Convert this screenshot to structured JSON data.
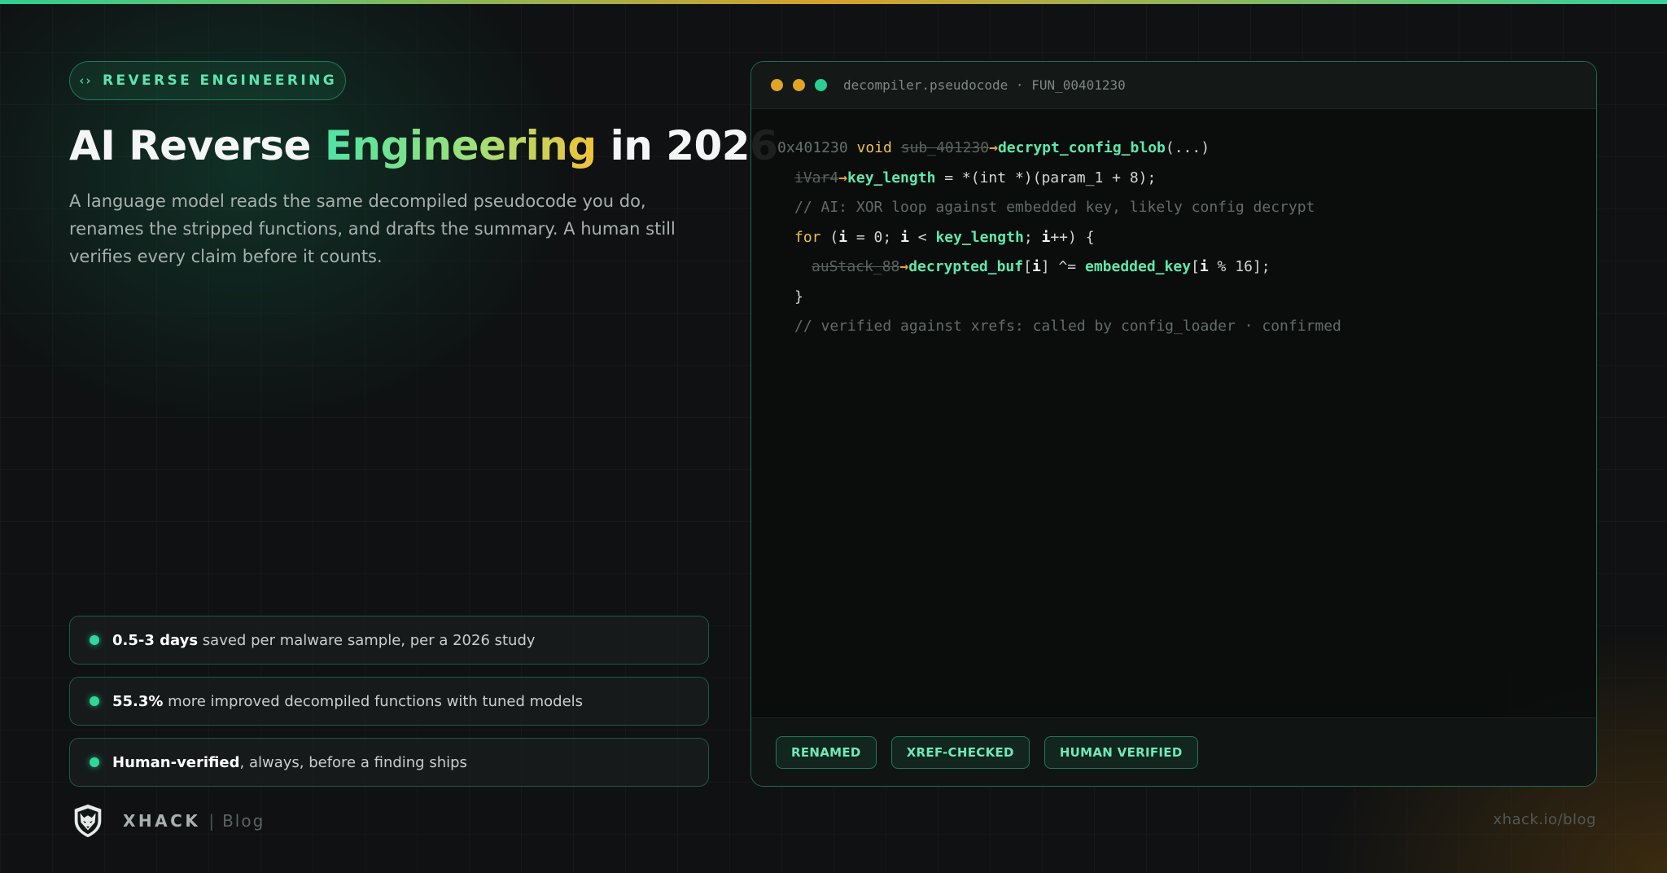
{
  "colors": {
    "accent_green": "#2fd896",
    "accent_amber": "#e0a526",
    "background": "#0f1112"
  },
  "header": {
    "tag_icon": "‹›",
    "tag_label": "REVERSE ENGINEERING",
    "title_before": "AI Reverse ",
    "title_accent": "Engineering",
    "title_after": " in 2026",
    "intro": "A language model reads the same decompiled pseudocode you do, renames the stripped functions, and drafts the summary. A human still verifies every claim before it counts."
  },
  "stats": [
    {
      "strong": "0.5-3 days",
      "rest": " saved per malware sample, per a 2026 study"
    },
    {
      "strong": "55.3%",
      "rest": " more improved decompiled functions with tuned models"
    },
    {
      "strong": "Human-verified",
      "rest": ", always, before a finding ships"
    }
  ],
  "footer": {
    "brand": "XHACK",
    "separator": "|",
    "sub": "Blog",
    "url": "xhack.io/blog",
    "logo_icon": "wolf-shield-icon"
  },
  "code_window": {
    "title": "decompiler.pseudocode · FUN_00401230",
    "traffic_icons": [
      "window-dot-icon",
      "window-dot-icon",
      "window-dot-icon"
    ],
    "lines": {
      "l1": {
        "addr": "0x401230",
        "kw": "void",
        "old": "sub_401230",
        "arrow": "→",
        "fn": "decrypt_config_blob",
        "tail": "(...)"
      },
      "l2": {
        "old": "iVar4",
        "arrow": "→",
        "fn": "key_length",
        "tail": " = *(int *)(param_1 + 8);"
      },
      "l3": {
        "comment": "// AI: XOR loop against embedded key, likely config decrypt"
      },
      "l4": {
        "kw": "for",
        "p1": " (",
        "v1": "i",
        "p2": " = 0; ",
        "v2": "i",
        "p3": " < ",
        "fn": "key_length",
        "p4": "; ",
        "v3": "i",
        "p5": "++) {"
      },
      "l5": {
        "old": "auStack_88",
        "arrow": "→",
        "fn1": "decrypted_buf",
        "p1": "[",
        "v1": "i",
        "p2": "] ^= ",
        "fn2": "embedded_key",
        "p3": "[",
        "v2": "i",
        "p4": " % 16];"
      },
      "l6": {
        "text": "}"
      },
      "l7": {
        "comment": "// verified against xrefs: called by config_loader · confirmed"
      }
    },
    "badges": [
      "RENAMED",
      "XREF-CHECKED",
      "HUMAN VERIFIED"
    ]
  }
}
